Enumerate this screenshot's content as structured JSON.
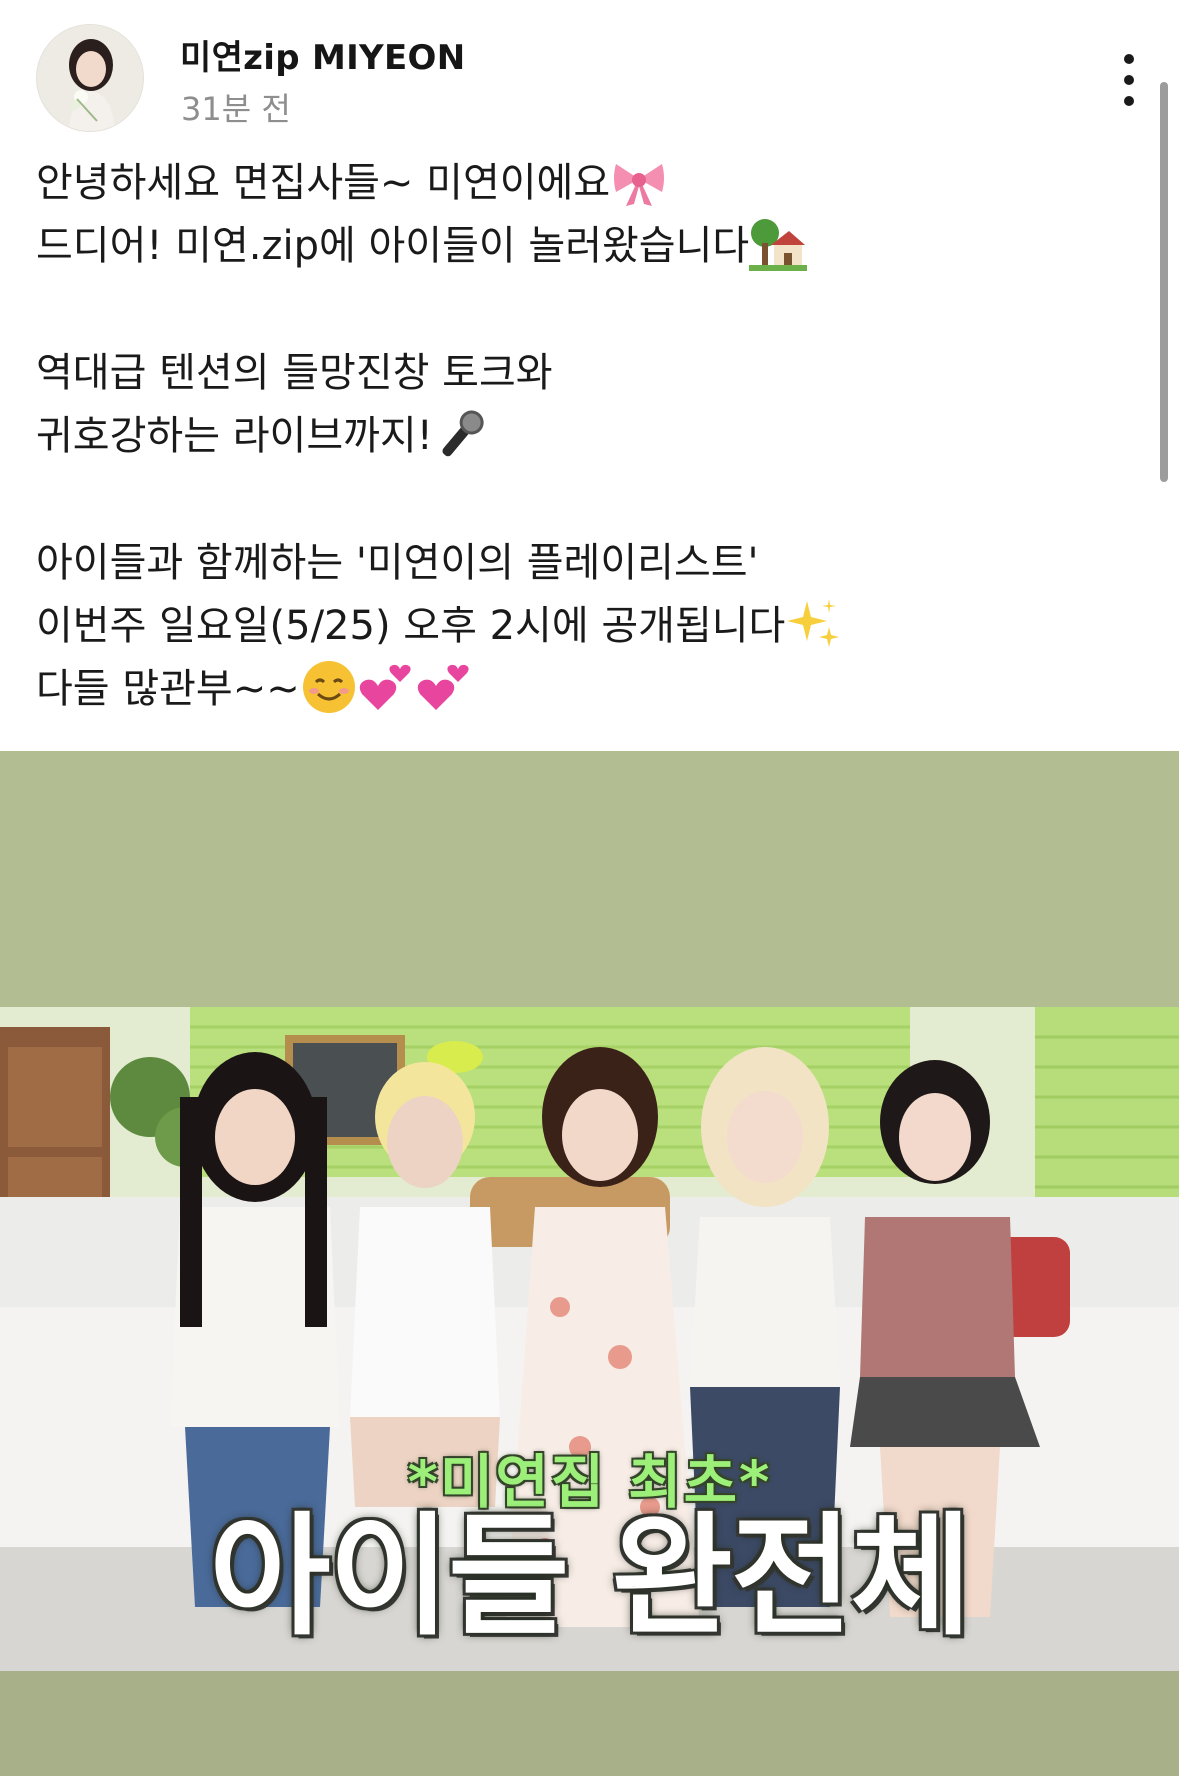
{
  "post": {
    "author": "미연zip MIYEON",
    "time": "31분 전",
    "lines": [
      {
        "text": "안녕하세요 면집사들~ 미연이에요",
        "emoji": [
          "ribbon-emoji"
        ]
      },
      {
        "text": "드디어! 미연.zip에 아이들이 놀러왔습니다",
        "emoji": [
          "house-with-garden-emoji"
        ]
      },
      {
        "text": ""
      },
      {
        "text": "역대급 텐션의 들망진창 토크와"
      },
      {
        "text": "귀호강하는 라이브까지!",
        "emoji": [
          "microphone-emoji"
        ]
      },
      {
        "text": ""
      },
      {
        "text": "아이들과 함께하는 '미연이의 플레이리스트'"
      },
      {
        "text": "이번주 일요일(5/25) 오후 2시에 공개됩니다",
        "emoji": [
          "sparkles-emoji"
        ]
      },
      {
        "text": "다들 많관부~~",
        "emoji": [
          "smiling-face-emoji",
          "two-hearts-emoji",
          "two-hearts-emoji"
        ]
      }
    ]
  },
  "media": {
    "overlay_subtitle": "*미연집 최초*",
    "overlay_title": "아이들 완전체",
    "backdrop_color": "#b2bd92"
  }
}
